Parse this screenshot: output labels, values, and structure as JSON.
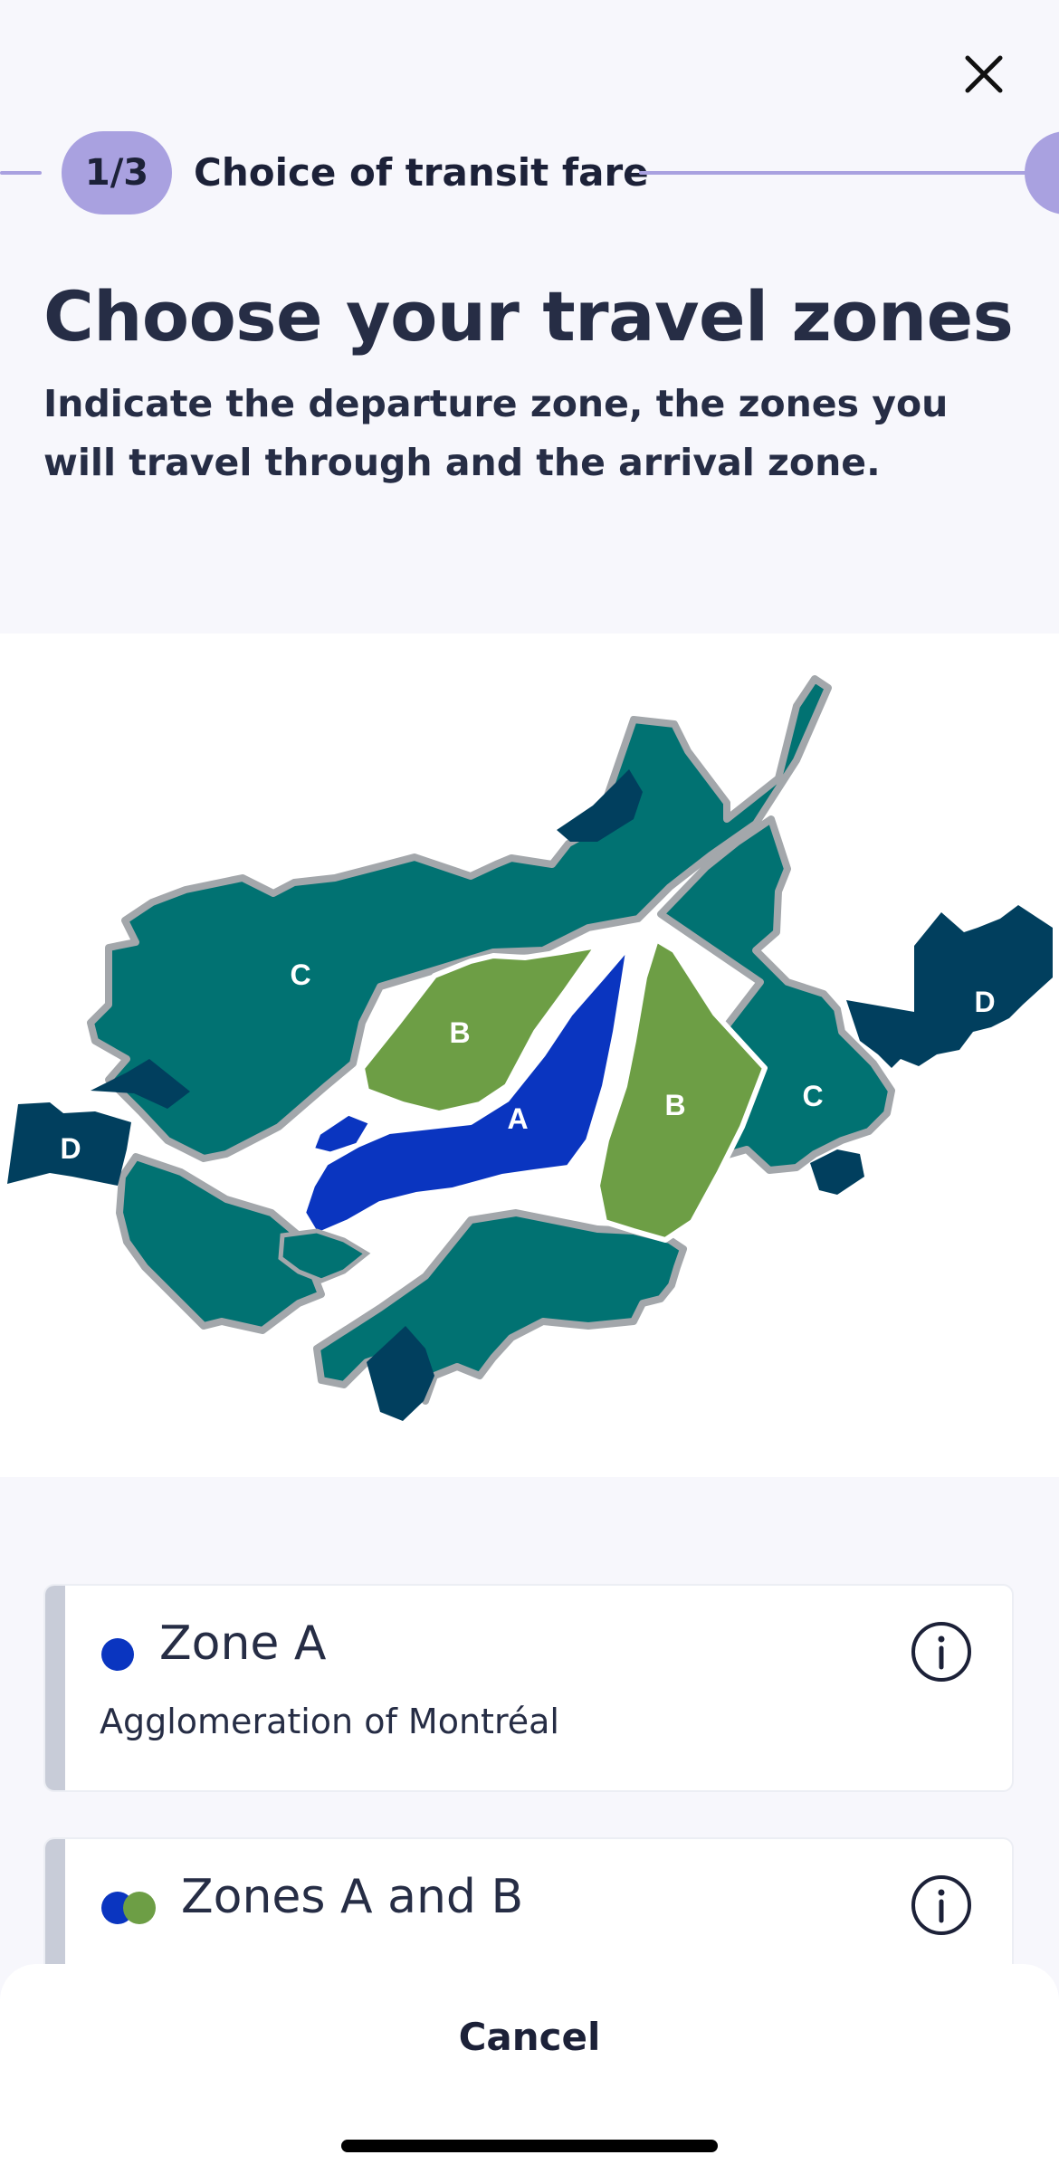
{
  "header": {
    "close_icon": "close-icon"
  },
  "stepper": {
    "step_number": "1/3",
    "step_label": "Choice of transit fare"
  },
  "page": {
    "title": "Choose your travel zones",
    "subtitle": "Indicate the departure zone, the zones you will travel through and the arrival zone."
  },
  "map": {
    "labels": {
      "a": "A",
      "b": "B",
      "c": "C",
      "d": "D"
    },
    "colors": {
      "zone_a": "#0a35c0",
      "zone_b": "#6d9e45",
      "zone_c": "#017272",
      "zone_d": "#013f5e",
      "border": "#a3a7ab"
    }
  },
  "zones": [
    {
      "title": "Zone A",
      "description": "Agglomeration of Montréal",
      "dot_colors": [
        "#0a35c0"
      ],
      "info_icon": "info-icon"
    },
    {
      "title": "Zones A and B",
      "description": "",
      "dot_colors": [
        "#0a35c0",
        "#6d9e45"
      ],
      "info_icon": "info-icon"
    }
  ],
  "footer": {
    "cancel_label": "Cancel"
  }
}
